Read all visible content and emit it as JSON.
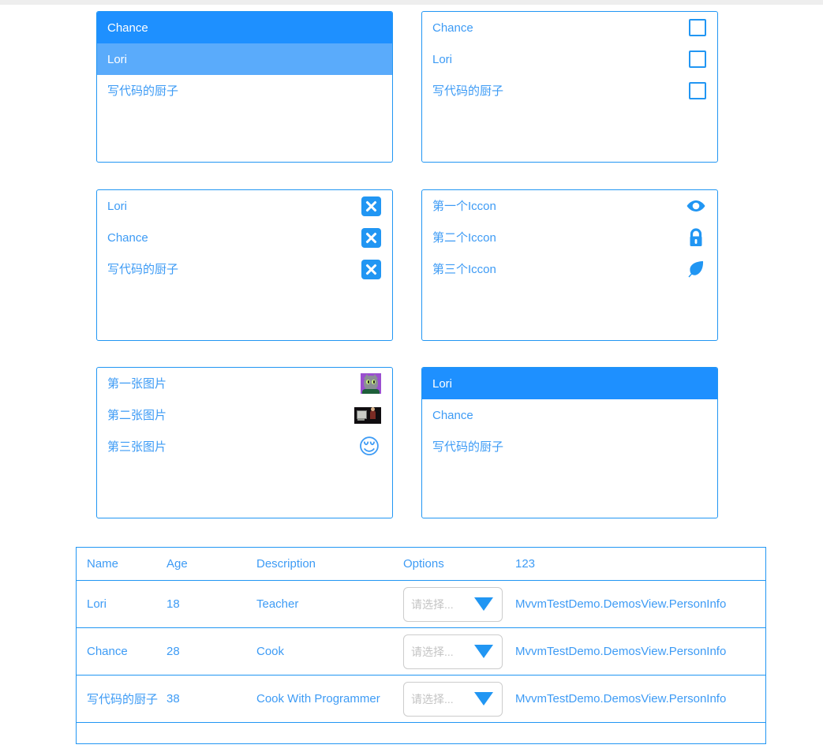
{
  "theme": {
    "accent": "#2196f3",
    "selected_bg": "#1e90ff",
    "hover_bg": "#5aabfb",
    "text_blue": "#3d9bf5",
    "placeholder_gray": "#c3c3c3",
    "top_strip": "#eeeeee"
  },
  "list_selected": {
    "items": [
      {
        "label": "Chance",
        "state": "selected"
      },
      {
        "label": "Lori",
        "state": "hover"
      },
      {
        "label": "写代码的厨子",
        "state": "normal"
      }
    ]
  },
  "list_checkbox": {
    "items": [
      {
        "label": "Chance",
        "checked": false
      },
      {
        "label": "Lori",
        "checked": false
      },
      {
        "label": "写代码的厨子",
        "checked": false
      }
    ]
  },
  "list_delete": {
    "items": [
      {
        "label": "Lori",
        "action": "delete"
      },
      {
        "label": "Chance",
        "action": "delete"
      },
      {
        "label": "写代码的厨子",
        "action": "delete"
      }
    ]
  },
  "list_icons": {
    "items": [
      {
        "label": "第一个Iccon",
        "icon": "eye-icon"
      },
      {
        "label": "第二个Iccon",
        "icon": "lock-icon"
      },
      {
        "label": "第三个Iccon",
        "icon": "leaf-icon"
      }
    ]
  },
  "list_images": {
    "items": [
      {
        "label": "第一张图片",
        "image": "cat-thumbnail"
      },
      {
        "label": "第二张图片",
        "image": "computer-thumbnail"
      },
      {
        "label": "第三张图片",
        "image": "sleeping-face-emoji"
      }
    ]
  },
  "list_plain": {
    "items": [
      {
        "label": "Lori",
        "state": "selected"
      },
      {
        "label": "Chance",
        "state": "normal"
      },
      {
        "label": "写代码的厨子",
        "state": "normal"
      }
    ]
  },
  "grid": {
    "columns": [
      "Name",
      "Age",
      "Description",
      "Options",
      "123"
    ],
    "combo_placeholder": "请选择...",
    "rows": [
      {
        "name": "Lori",
        "age": "18",
        "description": "Teacher",
        "option": "请选择...",
        "extra": "MvvmTestDemo.DemosView.PersonInfo"
      },
      {
        "name": "Chance",
        "age": "28",
        "description": "Cook",
        "option": "请选择...",
        "extra": "MvvmTestDemo.DemosView.PersonInfo"
      },
      {
        "name": "写代码的厨子",
        "age": "38",
        "description": "Cook With Programmer",
        "option": "请选择...",
        "extra": "MvvmTestDemo.DemosView.PersonInfo"
      }
    ]
  }
}
